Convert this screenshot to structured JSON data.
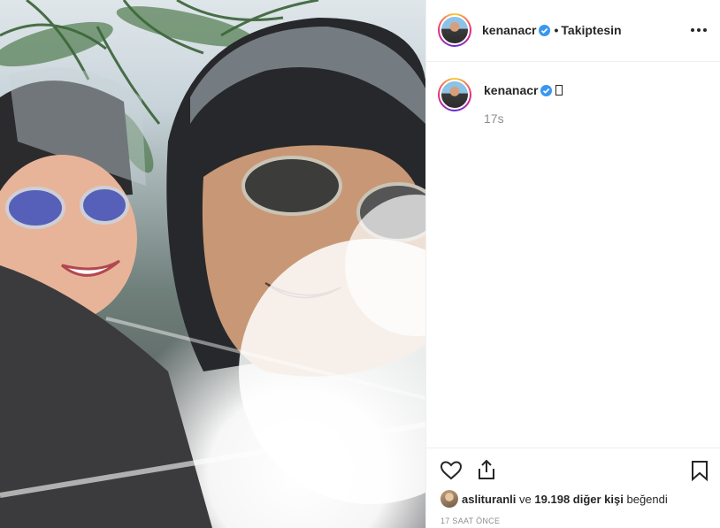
{
  "post": {
    "author": "kenanacr",
    "follow_label": "Takiptesin",
    "separator": "•",
    "caption_time": "17s",
    "likes": {
      "user": "aslituranli",
      "connector": "ve",
      "count_text": "19.198 diğer kişi",
      "suffix": "beğendi"
    },
    "posted_ago": "17 SAAT ÖNCE"
  },
  "icons": {
    "verified": "verified-badge-icon",
    "more": "more-options-icon",
    "like": "heart-icon",
    "share": "share-icon",
    "save": "bookmark-icon"
  },
  "colors": {
    "verified_blue": "#3897f0",
    "muted_text": "#8e8e8e",
    "divider": "#efefef"
  }
}
